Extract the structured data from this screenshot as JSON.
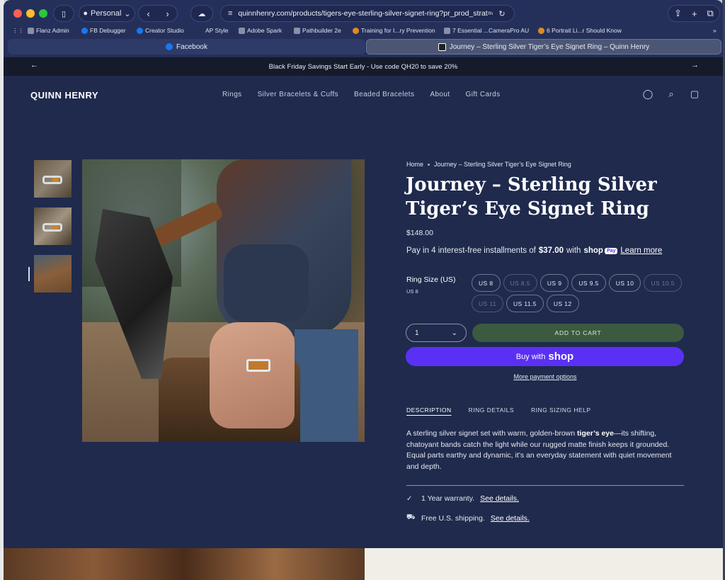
{
  "browser": {
    "profile": "Personal",
    "url": "quinnhenry.com/products/tigers-eye-sterling-silver-signet-ring?pr_prod_strat=e5",
    "bookmarks": [
      "Flanz Admin",
      "FB Debugger",
      "Creator Studio",
      "AP Style",
      "Adobe Spark",
      "Pathbuilder 2e",
      "Training for I...ry Prevention",
      "7 Essential ...CameraPro AU",
      "6 Portrait Li...r Should Know"
    ],
    "tabs": [
      "Facebook",
      "Journey – Sterling Silver Tiger’s Eye Signet Ring – Quinn Henry"
    ]
  },
  "announcement": "Black Friday Savings Start Early - Use code QH20 to save 20%",
  "header": {
    "logo": "QUINN HENRY",
    "nav": [
      "Rings",
      "Silver Bracelets & Cuffs",
      "Beaded Bracelets",
      "About",
      "Gift Cards"
    ]
  },
  "product": {
    "breadcrumb": [
      "Home",
      "Journey – Sterling Silver Tiger’s Eye Signet Ring"
    ],
    "title": "Journey – Sterling Silver Tiger’s Eye Signet Ring",
    "price": "$148.00",
    "installments_prefix": "Pay in 4 interest-free installments of",
    "installment_amount": "$37.00",
    "installments_with": "with",
    "shop_brand": "shop",
    "shop_pay_tag": "Pay",
    "learn_more": "Learn more",
    "size_label": "Ring Size (US)",
    "size_selected": "US 8",
    "sizes": [
      {
        "label": "US 8",
        "available": true
      },
      {
        "label": "US 8.5",
        "available": false
      },
      {
        "label": "US 9",
        "available": true
      },
      {
        "label": "US 9.5",
        "available": true
      },
      {
        "label": "US 10",
        "available": true
      },
      {
        "label": "US 10.5",
        "available": false
      },
      {
        "label": "US 11",
        "available": false
      },
      {
        "label": "US 11.5",
        "available": true
      },
      {
        "label": "US 12",
        "available": true
      }
    ],
    "quantity": "1",
    "add_to_cart": "ADD TO CART",
    "buy_with": "Buy with",
    "buy_brand": "shop",
    "more_payment": "More payment options",
    "tabs": [
      "DESCRIPTION",
      "RING DETAILS",
      "RING SIZING HELP"
    ],
    "description_before": "A sterling silver signet set with warm, golden-brown ",
    "description_bold": "tiger’s eye",
    "description_after": "—its shifting, chatoyant bands catch the light while our rugged matte finish keeps it grounded. Equal parts earthy and dynamic, it’s an everyday statement with quiet movement and depth.",
    "warranty_text": "1 Year warranty.",
    "shipping_text": "Free U.S. shipping.",
    "see_details": "See details."
  },
  "colors": {
    "page_bg": "#1f2a4d",
    "add_to_cart_bg": "#3b5a3f",
    "shop_pay_purple": "#5a31f4",
    "announcement_bg": "#161b2b"
  }
}
